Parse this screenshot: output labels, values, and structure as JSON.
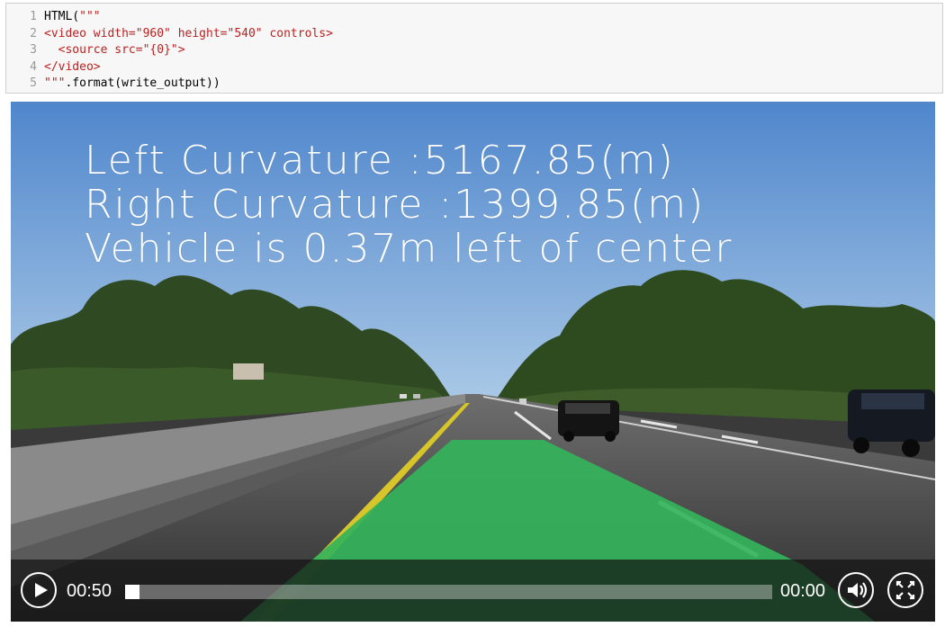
{
  "code_cell": {
    "line_numbers": [
      "1",
      "2",
      "3",
      "4",
      "5"
    ],
    "lines": [
      [
        {
          "t": "HTML(",
          "c": "plain"
        },
        {
          "t": "\"\"\"",
          "c": "str"
        }
      ],
      [
        {
          "t": "<video width=\"960\" height=\"540\" controls>",
          "c": "str"
        }
      ],
      [
        {
          "t": "  <source src=\"{0}\">",
          "c": "str"
        }
      ],
      [
        {
          "t": "</video>",
          "c": "str"
        }
      ],
      [
        {
          "t": "\"\"\"",
          "c": "str"
        },
        {
          "t": ".format(write_output))",
          "c": "plain"
        }
      ]
    ]
  },
  "video": {
    "overlay": {
      "left_curvature": "Left Curvature :5167.85(m)",
      "right_curvature": "Right Curvature :1399.85(m)",
      "vehicle_offset": "Vehicle is 0.37m left of center"
    },
    "controls": {
      "current_time": "00:50",
      "total_time": "00:00",
      "progress": 0.0,
      "play_icon": "play-icon",
      "volume_icon": "volume-icon",
      "fullscreen_icon": "fullscreen-icon"
    },
    "colors": {
      "sky": "#5a8fd0",
      "lane_overlay": "#34b35a",
      "road": "#3f3f3f"
    }
  }
}
